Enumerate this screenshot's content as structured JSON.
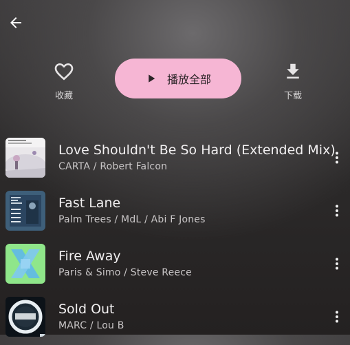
{
  "header": {
    "back_icon": "arrow-left-icon"
  },
  "actions": {
    "favorite_label": "收藏",
    "play_all_label": "播放全部",
    "download_label": "下载"
  },
  "colors": {
    "play_all_bg": "#f6b6d4",
    "text_primary": "#f2f0f1",
    "text_secondary": "#c9c6c7"
  },
  "tracks": [
    {
      "title": "Love Shouldn't Be So Hard (Extended Mix)",
      "artists": "CARTA / Robert Falcon"
    },
    {
      "title": "Fast Lane",
      "artists": "Palm Trees / MdL / Abi F Jones"
    },
    {
      "title": "Fire Away",
      "artists": "Paris & Simo / Steve Reece"
    },
    {
      "title": "Sold Out",
      "artists": "MARC / Lou B"
    }
  ]
}
